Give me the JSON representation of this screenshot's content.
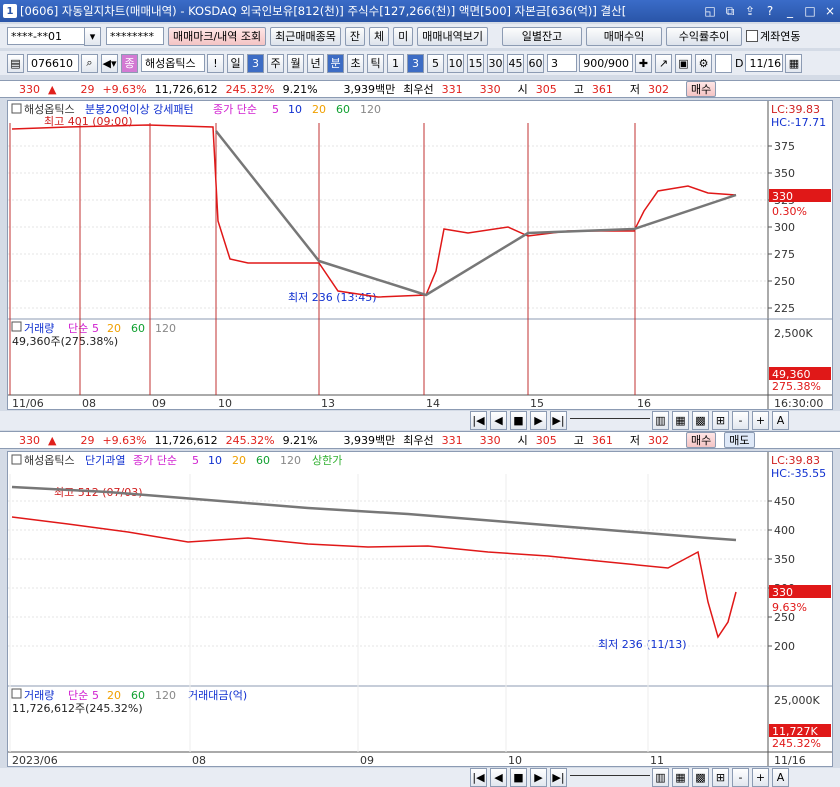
{
  "window": {
    "number": "1",
    "title": "[0606] 자동일지차트(매매내역) - KOSDAQ 외국인보유[812(천)] 주식수[127,266(천)] 액면[500] 자본금[636(억)] 결산["
  },
  "toolbar1": {
    "account": "****-**01",
    "password": "********",
    "btn_mark": "매매마크/내역 조회",
    "btn_recent": "최근매매종목",
    "btn_jan": "잔",
    "btn_che": "체",
    "btn_mi": "미",
    "btn_history": "매매내역보기",
    "btn_daily": "일별잔고",
    "btn_profit": "매매수익",
    "btn_rate": "수익률추이",
    "chk_link": "계좌연동"
  },
  "toolbar2": {
    "code": "076610",
    "name": "해성옵틱스",
    "excl": "!",
    "il": "일",
    "il_num": "3",
    "periods": [
      "주",
      "월",
      "년"
    ],
    "bun": "분",
    "cho": "초",
    "tick": "틱",
    "intervals": [
      "1",
      "3",
      "5",
      "10",
      "15",
      "30",
      "45",
      "60"
    ],
    "interval_val": "3",
    "count": "900/900",
    "d_label": "D",
    "date": "11/16"
  },
  "quote": {
    "price": "330",
    "arrow": "▲",
    "diff": "29",
    "pct": "+9.63%",
    "volume": "11,726,612",
    "vol_pct": "245.32%",
    "turnover": "9.21%",
    "amount": "3,939백만",
    "best_label": "최우선",
    "best": "331",
    "ask": "330",
    "si_label": "시",
    "open": "305",
    "go_label": "고",
    "high": "361",
    "jeo_label": "저",
    "low": "302",
    "buy": "매수",
    "sell": "매도"
  },
  "chart1": {
    "legend_name": "해성옵틱스",
    "legend_ind": "분봉20억이상 강세패턴",
    "legend_ma": "종가 단순",
    "ma": [
      "5",
      "10",
      "20",
      "60",
      "120"
    ],
    "lc": "LC:39.83",
    "hc": "HC:-17.71",
    "yticks": [
      "375",
      "350",
      "325",
      "300",
      "275",
      "250",
      "225"
    ],
    "price_tag": "330",
    "pct_tag": "0.30%",
    "ann_high": "최고 401 (09:00)",
    "ann_low": "최저 236 (13:45)",
    "vol_title": "거래량",
    "vol_ma": [
      "단순",
      "5",
      "20",
      "60",
      "120"
    ],
    "vol_value": "49,360주(275.38%)",
    "vol_ticks": [
      "2,500K"
    ],
    "vol_tag": "49,360",
    "vol_pct_tag": "275.38%",
    "xlabels": [
      "11/06",
      "08",
      "09",
      "10",
      "13",
      "14",
      "15",
      "16"
    ],
    "time": "16:30:00"
  },
  "chart2": {
    "legend_name": "해성옵틱스",
    "legend_ind": "단기과열",
    "legend_ma": "종가 단순",
    "ma": [
      "5",
      "10",
      "20",
      "60",
      "120"
    ],
    "legend_extra": "상한가",
    "lc": "LC:39.83",
    "hc": "HC:-35.55",
    "yticks": [
      "450",
      "400",
      "350",
      "300",
      "250",
      "200"
    ],
    "price_tag": "330",
    "pct_tag": "9.63%",
    "ann_high": "최고 512 (07/03)",
    "ann_low": "최저 236 (11/13)",
    "vol_title": "거래량",
    "vol_ma": [
      "단순",
      "5",
      "20",
      "60",
      "120"
    ],
    "vol_amt": "거래대금(억)",
    "vol_value": "11,726,612주(245.32%)",
    "vol_ticks": [
      "25,000K"
    ],
    "vol_tag": "11,727K",
    "vol_pct_tag": "245.32%",
    "xlabels": [
      "2023/06",
      "08",
      "09",
      "10",
      "11"
    ],
    "date": "11/16"
  },
  "scroll": {
    "minus": "-",
    "plus": "+",
    "a": "A"
  }
}
